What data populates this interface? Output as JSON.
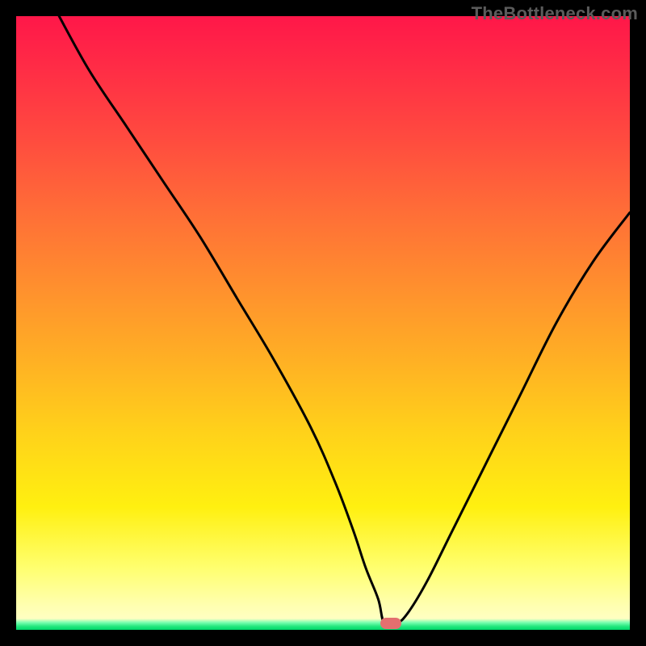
{
  "watermark": "TheBottleneck.com",
  "chart_data": {
    "type": "line",
    "title": "",
    "xlabel": "",
    "ylabel": "",
    "xlim": [
      0,
      100
    ],
    "ylim": [
      0,
      100
    ],
    "grid": false,
    "legend": false,
    "series": [
      {
        "name": "bottleneck-curve",
        "x": [
          7,
          12,
          18,
          24,
          30,
          36,
          42,
          48,
          52,
          55,
          57,
          59,
          60,
          62,
          64,
          67,
          71,
          76,
          82,
          88,
          94,
          100
        ],
        "values": [
          100,
          91,
          82,
          73,
          64,
          54,
          44,
          33,
          24,
          16,
          10,
          5,
          1,
          1,
          3,
          8,
          16,
          26,
          38,
          50,
          60,
          68
        ]
      }
    ],
    "annotations": [
      {
        "type": "marker",
        "shape": "pill",
        "x": 61,
        "y": 1,
        "color": "#e36f6f"
      }
    ],
    "background": {
      "type": "vertical-gradient",
      "stops": [
        {
          "pos": 0,
          "color": "#ff1749"
        },
        {
          "pos": 50,
          "color": "#ff902e"
        },
        {
          "pos": 80,
          "color": "#fff010"
        },
        {
          "pos": 98,
          "color": "#ffffd0"
        },
        {
          "pos": 100,
          "color": "#00d66a"
        }
      ]
    }
  }
}
